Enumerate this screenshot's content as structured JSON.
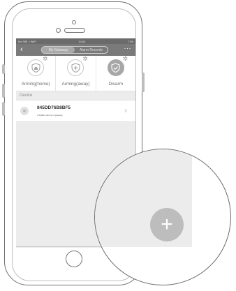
{
  "status_bar": {
    "left": "No SIM  • WiFi",
    "time": "14:42",
    "right": "71%"
  },
  "nav": {
    "back_icon": "chevron-left-icon",
    "tabs": [
      {
        "label": "My Gateway",
        "active": true
      },
      {
        "label": "Alarm Records",
        "active": false
      }
    ],
    "more_icon": "more-horizontal-icon"
  },
  "modes": [
    {
      "label": "Arming(home)",
      "icon": "shield-home-icon",
      "selected": false
    },
    {
      "label": "Arming(away)",
      "icon": "shield-plus-icon",
      "selected": false
    },
    {
      "label": "Disarm",
      "icon": "shield-check-icon",
      "selected": true
    }
  ],
  "device_section": {
    "title": "Device",
    "items": [
      {
        "name": "845DD76B8BF5",
        "subtitle": "0 ZigBee device in gateway"
      }
    ]
  },
  "fab": {
    "label": "+"
  },
  "colors": {
    "nav_bg": "#7a7a7a",
    "status_bg": "#6b6b6b",
    "screen_bg": "#ececec",
    "fab_bg": "#bdbdbd"
  }
}
